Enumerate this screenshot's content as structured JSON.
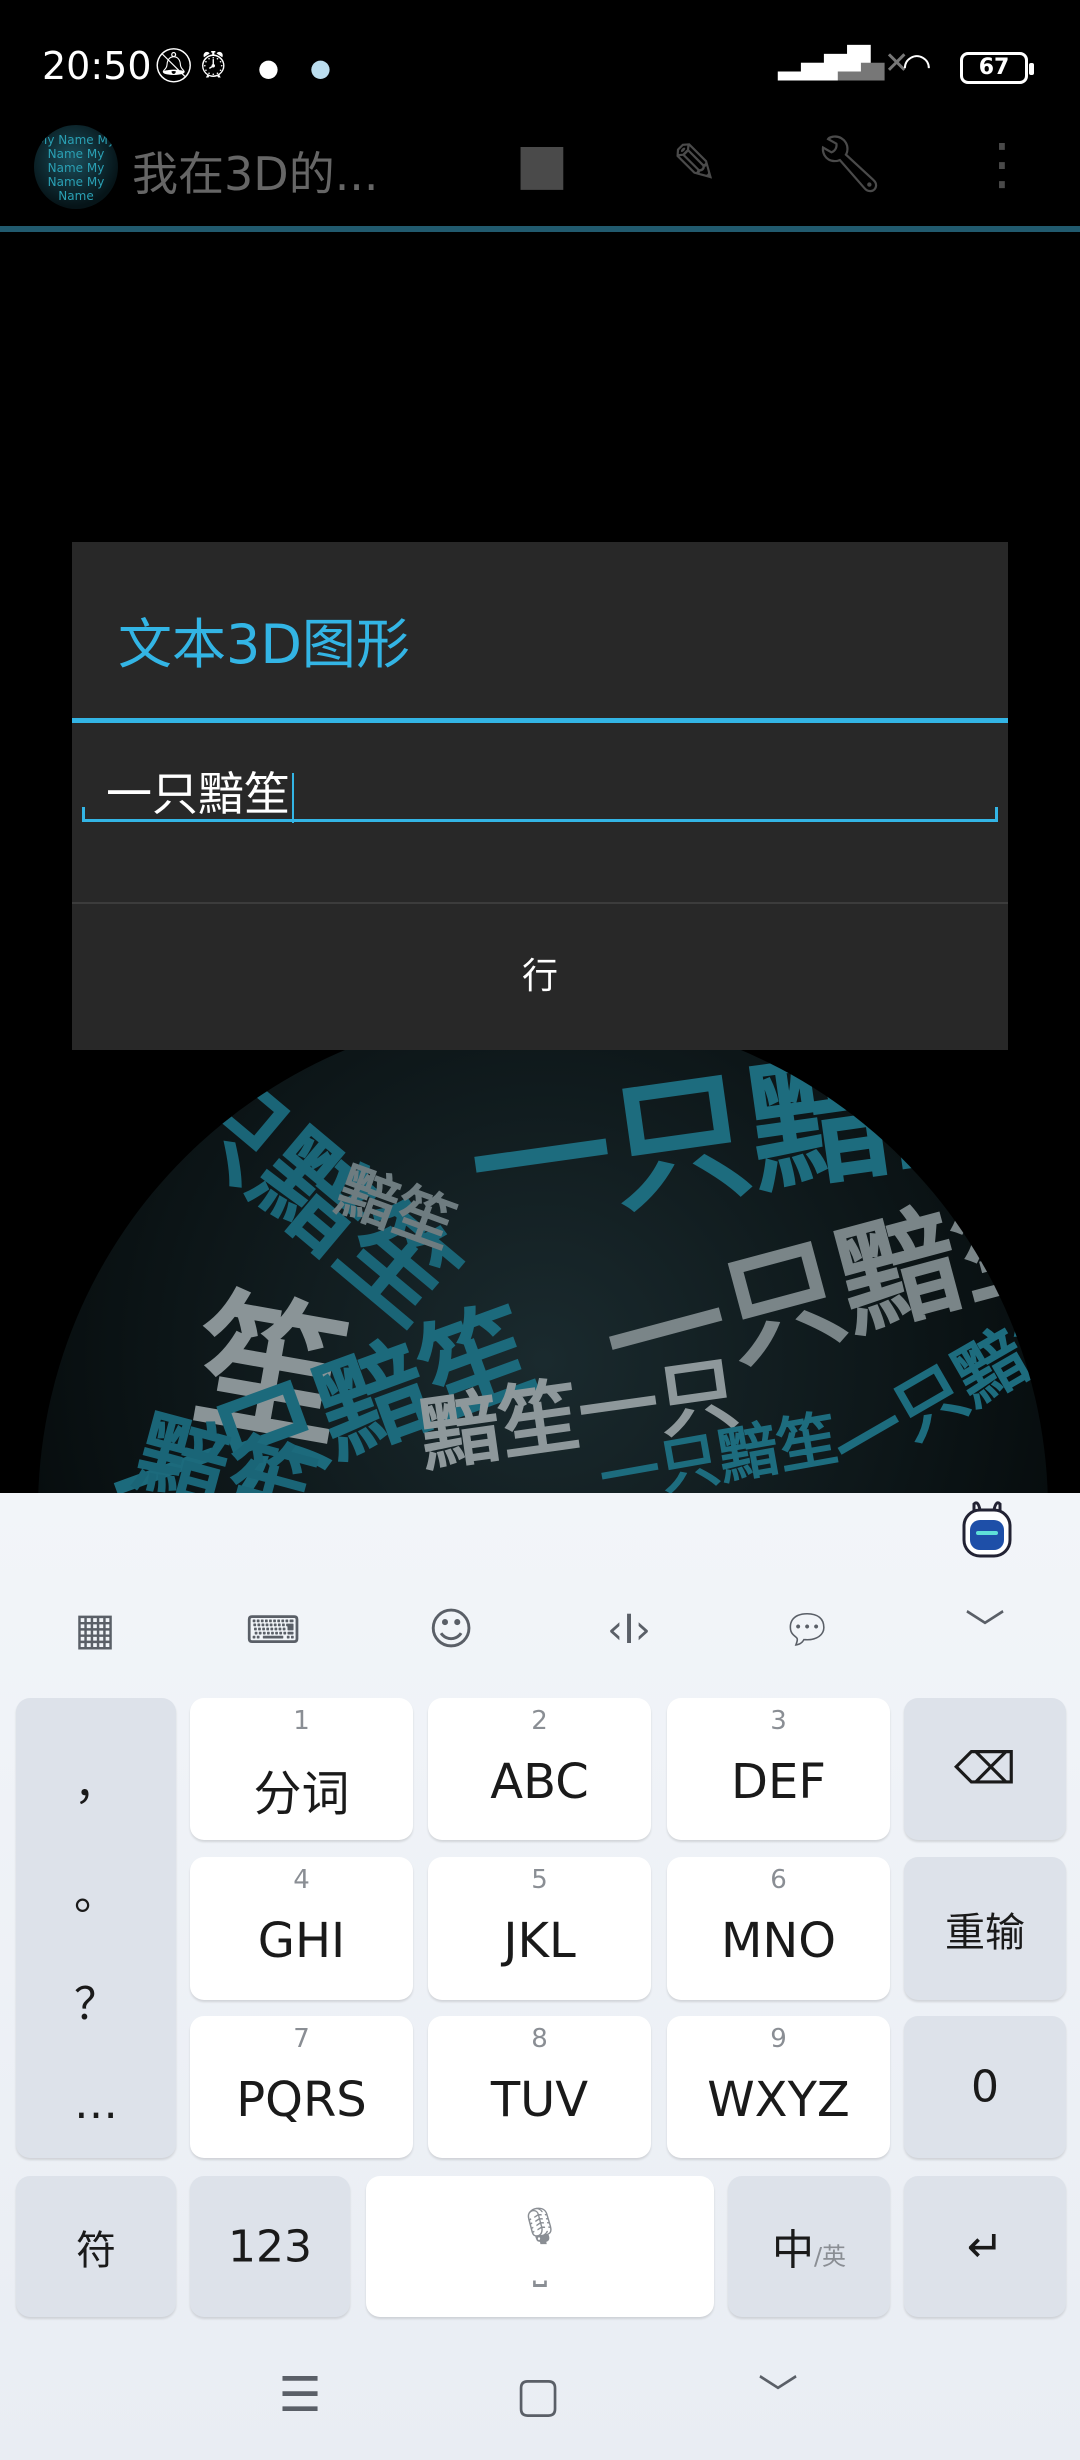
{
  "status_bar": {
    "time": "20:50",
    "battery": "67",
    "icons": [
      "bell-off-icon",
      "alarm-icon",
      "app-notification-icon",
      "app-notification-icon",
      "hd-signal-icon",
      "signal-no-service-icon",
      "wifi-icon",
      "battery-icon"
    ]
  },
  "toolbar": {
    "logo_text": "My Name My Name My Name My Name My Name",
    "title": "我在3D的...",
    "actions": [
      "video-camera-icon",
      "pencil-icon",
      "wrench-icon",
      "more-vert-icon"
    ]
  },
  "globe": {
    "words": [
      "一只黯笙",
      "一只黯笙",
      "黯笙",
      "一只黯笙",
      "笙",
      "一只黯笙",
      "黯笙一只",
      "一只黯笙",
      "黯笙",
      "一只黯笙"
    ]
  },
  "dialog": {
    "title": "文本3D图形",
    "input_value": "一只黯笙",
    "ok_label": "行"
  },
  "keyboard": {
    "toolbar": [
      "apps-icon",
      "keyboard-icon",
      "emoji-icon",
      "cursor-icon",
      "clipboard-icon",
      "collapse-icon"
    ],
    "punctuation": [
      "，",
      "。",
      "？",
      "…"
    ],
    "rows": [
      [
        {
          "num": "1",
          "label": "分词"
        },
        {
          "num": "2",
          "label": "ABC"
        },
        {
          "num": "3",
          "label": "DEF"
        }
      ],
      [
        {
          "num": "4",
          "label": "GHI"
        },
        {
          "num": "5",
          "label": "JKL"
        },
        {
          "num": "6",
          "label": "MNO"
        }
      ],
      [
        {
          "num": "7",
          "label": "PQRS"
        },
        {
          "num": "8",
          "label": "TUV"
        },
        {
          "num": "9",
          "label": "WXYZ"
        }
      ]
    ],
    "reenter": "重输",
    "zero": "0",
    "symbols": "符",
    "numbers": "123",
    "lang_main": "中",
    "lang_alt": "/英"
  },
  "colors": {
    "accent": "#33b5e5",
    "dialog_bg": "#282828",
    "keyboard_bg": "#f2f5f9"
  }
}
